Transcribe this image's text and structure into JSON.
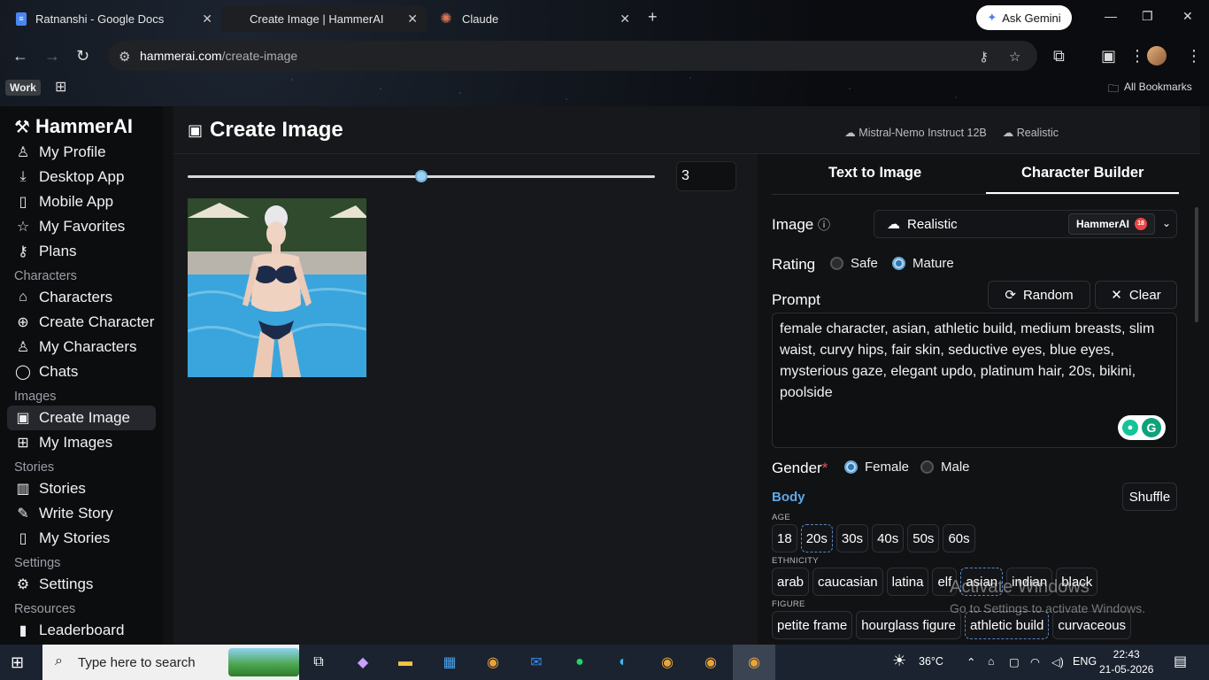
{
  "browser": {
    "tabs": [
      {
        "title": "Ratnanshi - Google Docs"
      },
      {
        "title": "Create Image | HammerAI"
      },
      {
        "title": "Claude"
      }
    ],
    "gemini_label": "Ask Gemini",
    "url_host": "hammerai.com",
    "url_path": "/create-image",
    "profile_chip": "Work",
    "all_bookmarks": "All Bookmarks"
  },
  "sidebar": {
    "brand": "HammerAI",
    "items": [
      {
        "label": "My Profile"
      },
      {
        "label": "Desktop App"
      },
      {
        "label": "Mobile App"
      },
      {
        "label": "My Favorites"
      },
      {
        "label": "Plans"
      }
    ],
    "sections": {
      "characters": "Characters",
      "images": "Images",
      "stories": "Stories",
      "settings": "Settings",
      "resources": "Resources"
    },
    "character_items": [
      {
        "label": "Characters"
      },
      {
        "label": "Create Character"
      },
      {
        "label": "My Characters"
      },
      {
        "label": "Chats"
      }
    ],
    "image_items": [
      {
        "label": "Create Image"
      },
      {
        "label": "My Images"
      }
    ],
    "story_items": [
      {
        "label": "Stories"
      },
      {
        "label": "Write Story"
      },
      {
        "label": "My Stories"
      }
    ],
    "settings_items": [
      {
        "label": "Settings"
      }
    ],
    "resource_items": [
      {
        "label": "Leaderboard"
      }
    ]
  },
  "main": {
    "title": "Create Image",
    "model": "Mistral-Nemo Instruct 12B",
    "style": "Realistic",
    "image_count": "3",
    "slider_fraction": 0.5
  },
  "panel": {
    "tabs": [
      "Text to Image",
      "Character Builder"
    ],
    "image_label": "Image",
    "image_value": "Realistic",
    "image_provider": "HammerAI",
    "rating_label": "Rating",
    "rating_options": [
      "Safe",
      "Mature"
    ],
    "prompt_label": "Prompt",
    "random_label": "Random",
    "clear_label": "Clear",
    "prompt_text": "female character, asian, athletic build, medium breasts, slim waist, curvy hips, fair skin, seductive eyes, blue eyes, mysterious gaze, elegant updo, platinum hair, 20s, bikini, poolside",
    "gender_label": "Gender",
    "gender_required": "*",
    "gender_options": [
      "Female",
      "Male"
    ],
    "body_label": "Body",
    "shuffle_label": "Shuffle",
    "age_label": "AGE",
    "ages": [
      "18",
      "20s",
      "30s",
      "40s",
      "50s",
      "60s"
    ],
    "ethnicity_label": "ETHNICITY",
    "ethnicities": [
      "arab",
      "caucasian",
      "latina",
      "elf",
      "asian",
      "indian",
      "black"
    ],
    "figure_label": "FIGURE",
    "figures": [
      "petite frame",
      "hourglass figure",
      "athletic build",
      "curvaceous"
    ]
  },
  "windows": {
    "activate_title": "Activate Windows",
    "activate_sub": "Go to Settings to activate Windows."
  },
  "taskbar": {
    "search_placeholder": "Type here to search",
    "weather": "36°C",
    "lang": "ENG",
    "time": "22:43",
    "date": "21-05-2026"
  }
}
